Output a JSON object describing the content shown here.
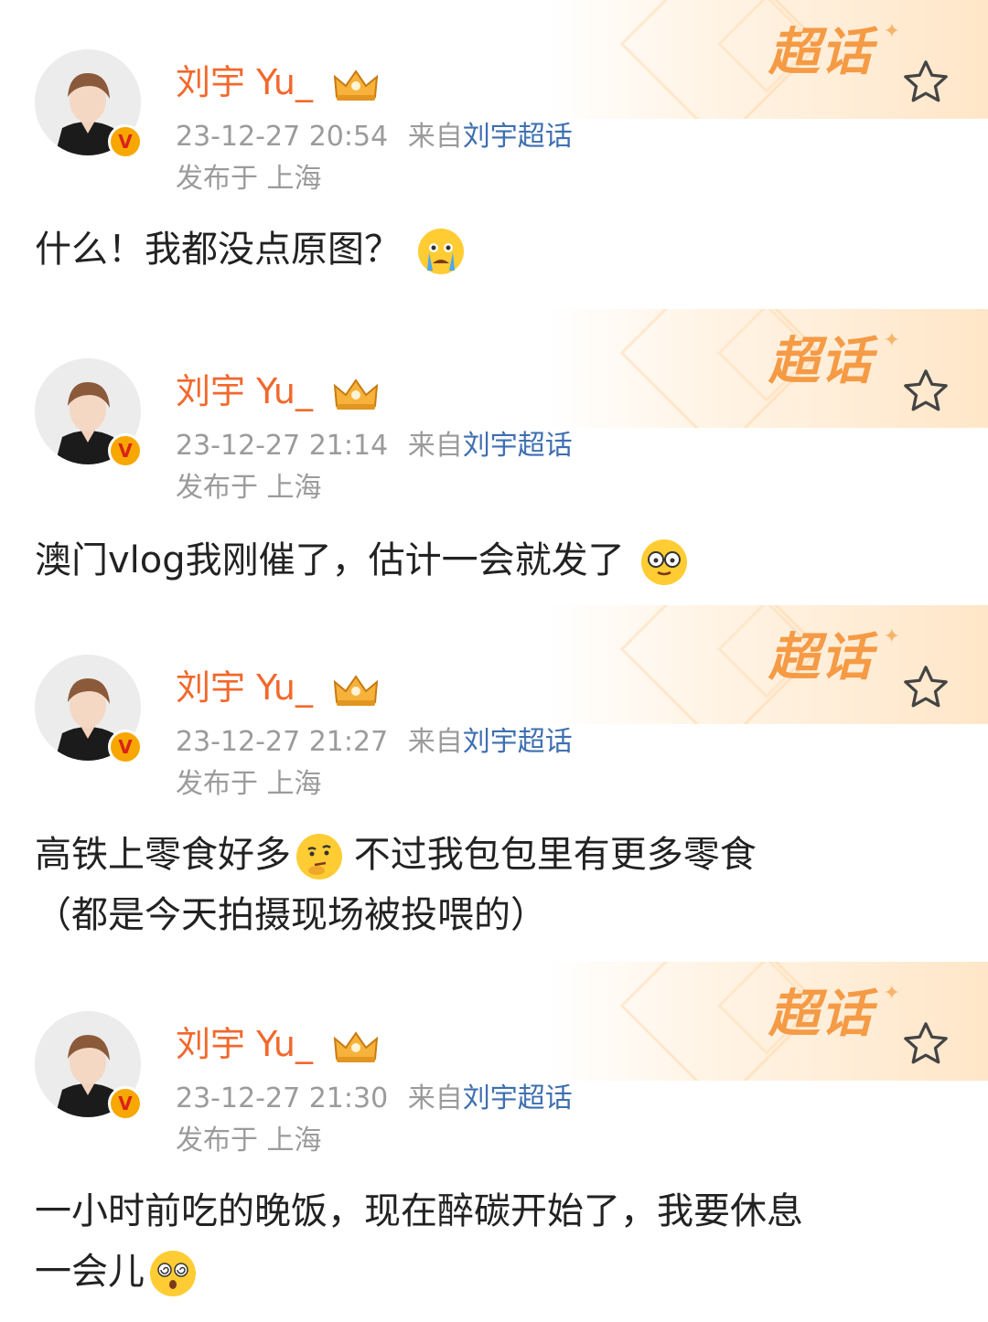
{
  "posts": [
    {
      "user": "刘宇 Yu_",
      "time": "23-12-27 20:54",
      "from_label": "来自",
      "source": "刘宇超话",
      "location": "发布于 上海",
      "banner_text": "超话",
      "content": "什么！我都没点原图？",
      "emoji": "crying-face-icon"
    },
    {
      "user": "刘宇 Yu_",
      "time": "23-12-27 21:14",
      "from_label": "来自",
      "source": "刘宇超话",
      "location": "发布于 上海",
      "banner_text": "超话",
      "content": "澳门vlog我刚催了，估计一会就发了",
      "emoji": "glasses-face-icon"
    },
    {
      "user": "刘宇 Yu_",
      "time": "23-12-27 21:27",
      "from_label": "来自",
      "source": "刘宇超话",
      "location": "发布于 上海",
      "banner_text": "超话",
      "content_line1_a": "高铁上零食好多",
      "content_line1_b": " 不过我包包里有更多零食",
      "content_line2": "（都是今天拍摄现场被投喂的）",
      "emoji": "thinking-face-icon"
    },
    {
      "user": "刘宇 Yu_",
      "time": "23-12-27 21:30",
      "from_label": "来自",
      "source": "刘宇超话",
      "location": "发布于 上海",
      "banner_text": "超话",
      "content_line1": "一小时前吃的晚饭，现在醉碳开始了，我要休息",
      "content_line2": "一会儿",
      "emoji": "dizzy-face-icon"
    }
  ],
  "colors": {
    "username": "#f2682c",
    "source_link": "#3e6fb0",
    "meta": "#9b9b9b",
    "banner_text": "#f59a45"
  }
}
